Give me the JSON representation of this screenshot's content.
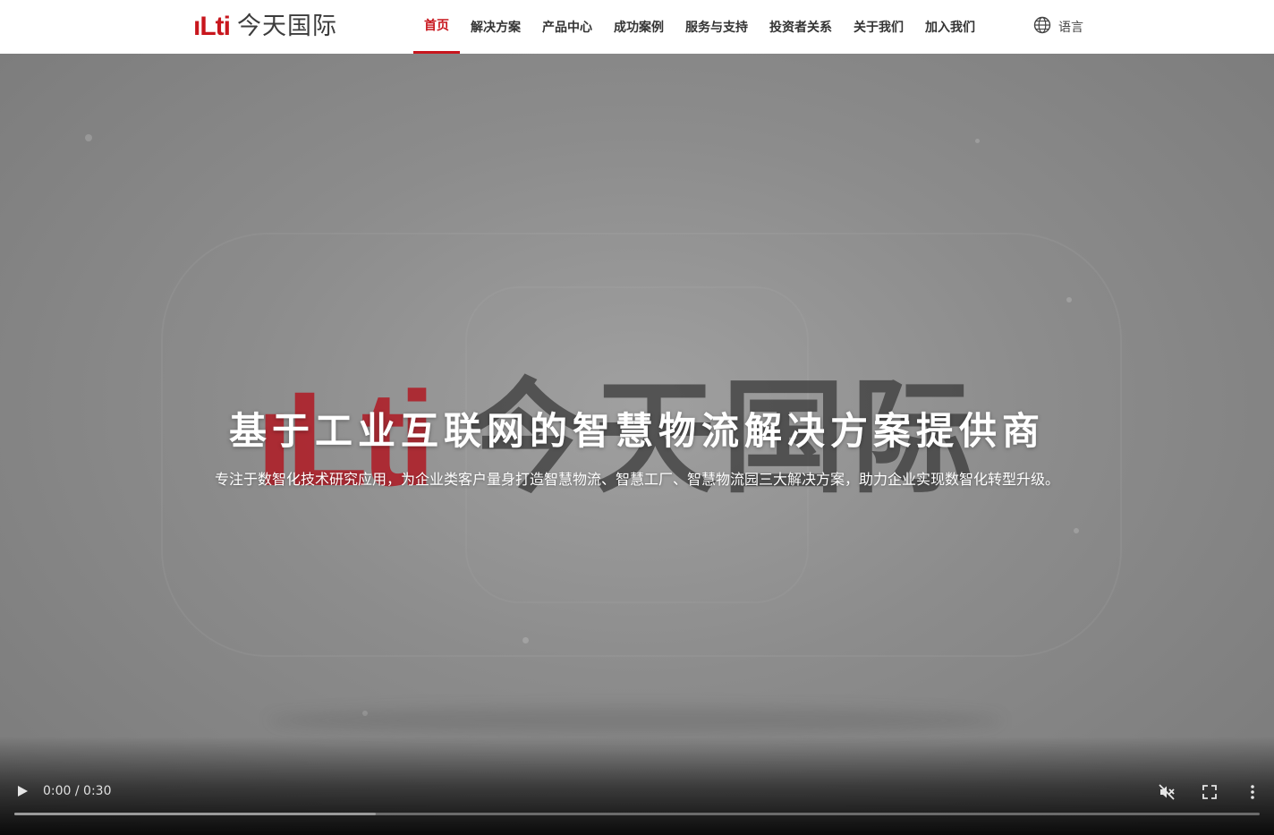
{
  "header": {
    "logo_mark": "ıLti",
    "logo_text": "今天国际",
    "nav": [
      {
        "label": "首页",
        "active": true
      },
      {
        "label": "解决方案",
        "active": false
      },
      {
        "label": "产品中心",
        "active": false
      },
      {
        "label": "成功案例",
        "active": false
      },
      {
        "label": "服务与支持",
        "active": false
      },
      {
        "label": "投资者关系",
        "active": false
      },
      {
        "label": "关于我们",
        "active": false
      },
      {
        "label": "加入我们",
        "active": false
      }
    ],
    "language_label": "语言",
    "language_icon": "globe-icon"
  },
  "hero": {
    "bg_logo_mark": "ıLti",
    "bg_logo_text": "今天国际",
    "title": "基于工业互联网的智慧物流解决方案提供商",
    "subtitle": "专注于数智化技术研究应用，为企业类客户量身打造智慧物流、智慧工厂、智慧物流园三大解决方案，助力企业实现数智化转型升级。"
  },
  "video": {
    "time": "0:00 / 0:30",
    "buffered_fraction": 0.29,
    "play_icon": "play-icon",
    "mute_icon": "volume-muted-icon",
    "fullscreen_icon": "fullscreen-icon",
    "menu_icon": "more-vertical-icon"
  },
  "colors": {
    "brand_red": "#c8161d",
    "nav_text": "#333333"
  }
}
